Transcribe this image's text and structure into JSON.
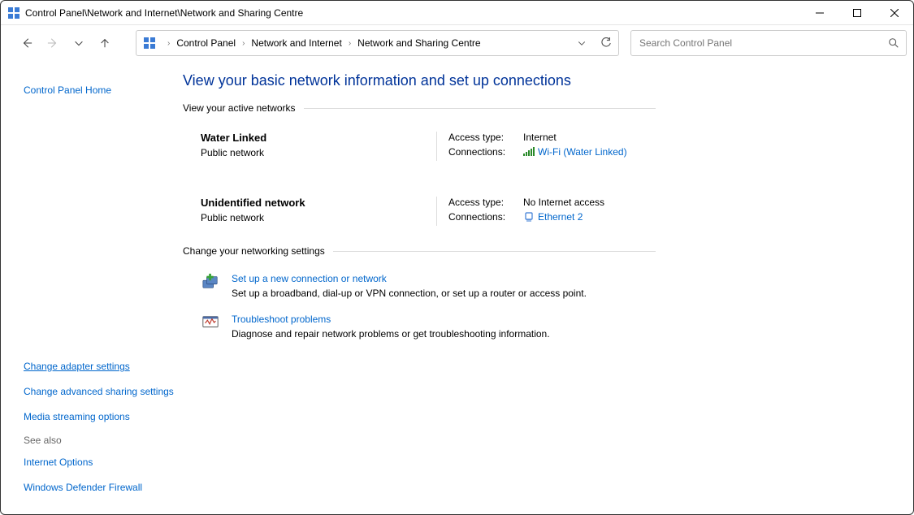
{
  "window": {
    "title": "Control Panel\\Network and Internet\\Network and Sharing Centre"
  },
  "breadcrumb": {
    "root": "Control Panel",
    "mid": "Network and Internet",
    "leaf": "Network and Sharing Centre"
  },
  "search": {
    "placeholder": "Search Control Panel"
  },
  "sidebar": {
    "home": "Control Panel Home",
    "adapter": "Change adapter settings",
    "advanced": "Change advanced sharing settings",
    "media": "Media streaming options",
    "see_also_head": "See also",
    "internet_options": "Internet Options",
    "firewall": "Windows Defender Firewall"
  },
  "main": {
    "heading": "View your basic network information and set up connections",
    "active_header": "View your active networks",
    "settings_header": "Change your networking settings",
    "networks": [
      {
        "name": "Water Linked",
        "type": "Public network",
        "access_label": "Access type:",
        "access_value": "Internet",
        "conn_label": "Connections:",
        "conn_value": "Wi-Fi (Water Linked)",
        "conn_kind": "wifi"
      },
      {
        "name": "Unidentified network",
        "type": "Public network",
        "access_label": "Access type:",
        "access_value": "No Internet access",
        "conn_label": "Connections:",
        "conn_value": "Ethernet 2",
        "conn_kind": "ethernet"
      }
    ],
    "setup": {
      "title": "Set up a new connection or network",
      "desc": "Set up a broadband, dial-up or VPN connection, or set up a router or access point."
    },
    "troubleshoot": {
      "title": "Troubleshoot problems",
      "desc": "Diagnose and repair network problems or get troubleshooting information."
    }
  }
}
